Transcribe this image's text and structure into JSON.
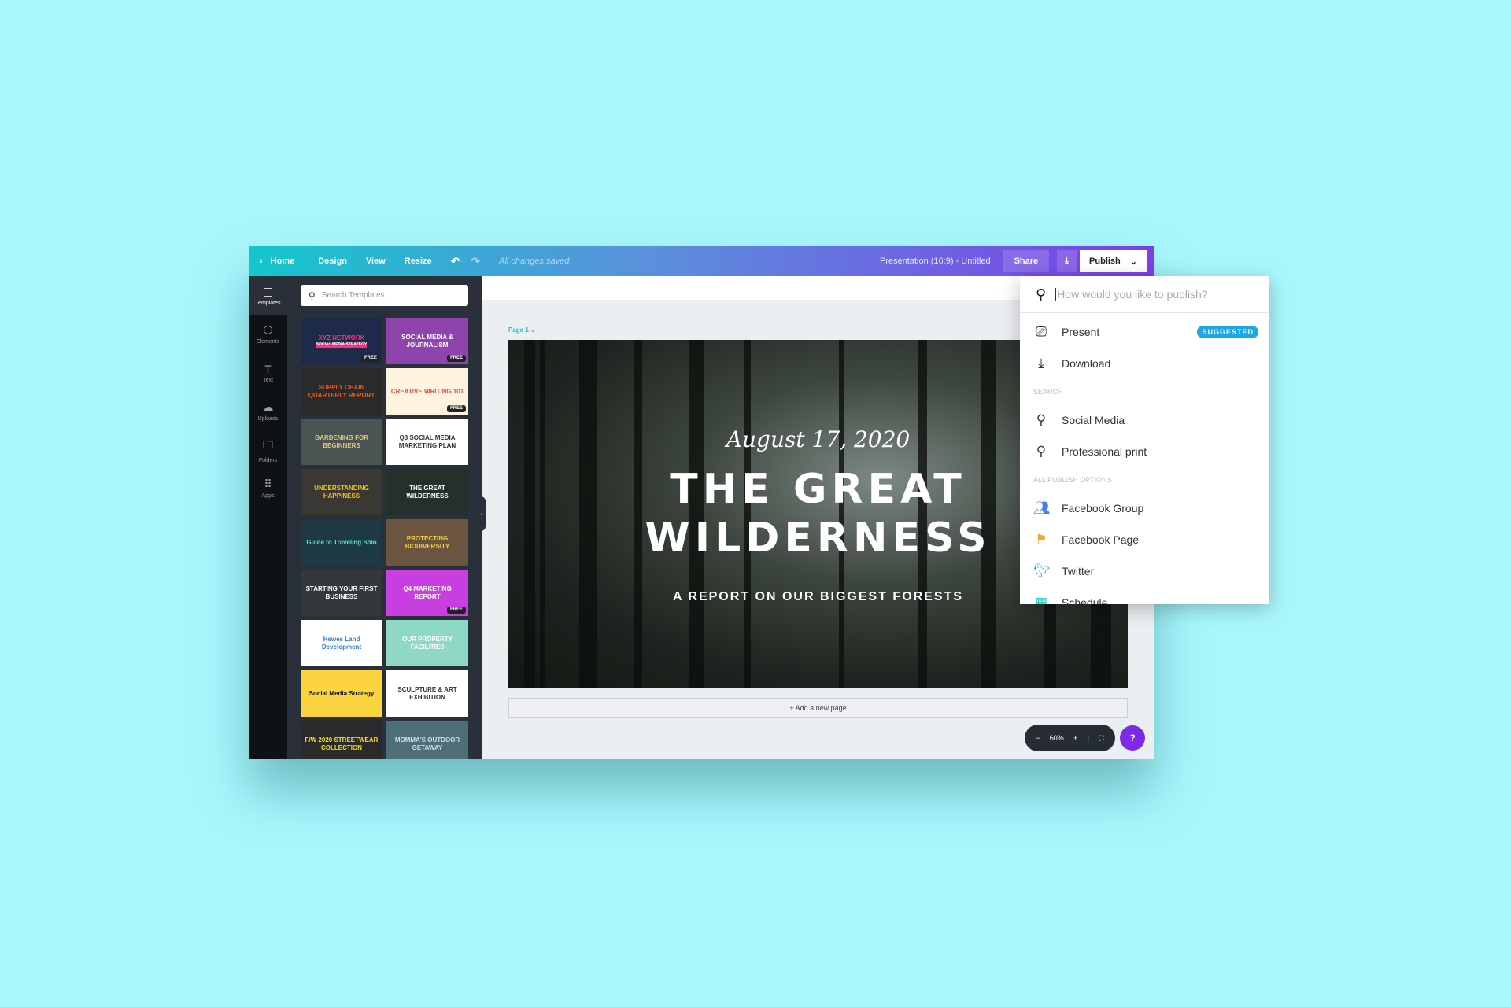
{
  "topbar": {
    "home": "Home",
    "design": "Design",
    "view": "View",
    "resize": "Resize",
    "saved": "All changes saved",
    "title": "Presentation (16:9) - Untitled",
    "share": "Share",
    "publish": "Publish"
  },
  "rail": [
    {
      "label": "Templates",
      "icon": "layout-icon"
    },
    {
      "label": "Elements",
      "icon": "shapes-icon"
    },
    {
      "label": "Text",
      "icon": "text-icon"
    },
    {
      "label": "Uploads",
      "icon": "cloud-upload-icon"
    },
    {
      "label": "Folders",
      "icon": "folder-icon"
    },
    {
      "label": "Apps",
      "icon": "apps-grid-icon"
    }
  ],
  "panel": {
    "search_placeholder": "Search Templates",
    "free": "FREE",
    "thumbs": [
      {
        "title": "XYZ NETWORK",
        "sub": "SOCIAL MEDIA STRATEGY",
        "bg": "#1d2a4a",
        "fg": "#ff2e7e",
        "free": true
      },
      {
        "title": "SOCIAL MEDIA & JOURNALISM",
        "bg": "#8e44ad",
        "fg": "#fff",
        "free": true
      },
      {
        "title": "SUPPLY CHAIN QUARTERLY REPORT",
        "bg": "#2a2a2a",
        "fg": "#f05a1a",
        "free": false
      },
      {
        "title": "CREATIVE WRITING 101",
        "bg": "#fdf3de",
        "fg": "#e74c3c",
        "free": true
      },
      {
        "title": "GARDENING FOR BEGINNERS",
        "bg": "#4a5552",
        "fg": "#e0c48a",
        "free": false
      },
      {
        "title": "Q3 SOCIAL MEDIA MARKETING PLAN",
        "bg": "#ffffff",
        "fg": "#333",
        "free": false
      },
      {
        "title": "UNDERSTANDING HAPPINESS",
        "bg": "#3a3832",
        "fg": "#f5c518",
        "free": false
      },
      {
        "title": "THE GREAT WILDERNESS",
        "bg": "#25302a",
        "fg": "#fff",
        "free": false
      },
      {
        "title": "Guide to Traveling Solo",
        "bg": "#1d3a44",
        "fg": "#5fe0c8",
        "free": false
      },
      {
        "title": "PROTECTING BIODIVERSITY",
        "bg": "#6b5440",
        "fg": "#f5d33b",
        "free": false
      },
      {
        "title": "STARTING YOUR FIRST BUSINESS",
        "bg": "#33383d",
        "fg": "#fff",
        "free": false
      },
      {
        "title": "Q4 MARKETING REPORT",
        "bg": "#c93ee0",
        "fg": "#fff",
        "free": true
      },
      {
        "title": "Hewes Land Development",
        "bg": "#ffffff",
        "fg": "#2e7be0",
        "free": false
      },
      {
        "title": "OUR PROPERTY FACILITIES",
        "bg": "#8ed8c4",
        "fg": "#fff",
        "free": false
      },
      {
        "title": "Social Media Strategy",
        "bg": "#fcd440",
        "fg": "#111",
        "free": false
      },
      {
        "title": "SCULPTURE & ART EXHIBITION",
        "bg": "#ffffff",
        "fg": "#333",
        "free": false
      },
      {
        "title": "F/W 2020 STREETWEAR COLLECTION",
        "bg": "#2a2a2a",
        "fg": "#f5e021",
        "free": false
      },
      {
        "title": "MOMMA'S OUTDOOR GETAWAY",
        "bg": "#4e6f78",
        "fg": "#cfe0e4",
        "free": false
      }
    ]
  },
  "canvas": {
    "page_label": "Page 1",
    "date": "August 17, 2020",
    "title_line1": "THE GREAT",
    "title_line2": "WILDERNESS",
    "subtitle": "A REPORT ON OUR BIGGEST FORESTS",
    "add_page": "+ Add a new page",
    "zoom": "60%",
    "help": "?"
  },
  "publish_menu": {
    "placeholder": "How would you like to publish?",
    "suggested": "SUGGESTED",
    "top": [
      {
        "label": "Present",
        "icon": "presentation-icon"
      },
      {
        "label": "Download",
        "icon": "download-icon"
      }
    ],
    "search_header": "SEARCH",
    "search": [
      {
        "label": "Social Media"
      },
      {
        "label": "Professional print"
      }
    ],
    "all_header": "ALL PUBLISH OPTIONS",
    "all": [
      {
        "label": "Facebook Group",
        "icon": "facebook-group-icon",
        "color": "#4a7bf0"
      },
      {
        "label": "Facebook Page",
        "icon": "flag-icon",
        "color": "#f7a23a"
      },
      {
        "label": "Twitter",
        "icon": "twitter-icon",
        "color": "#1da1f2"
      },
      {
        "label": "Schedule",
        "icon": "calendar-icon",
        "color": "#1cc7c0"
      }
    ]
  }
}
